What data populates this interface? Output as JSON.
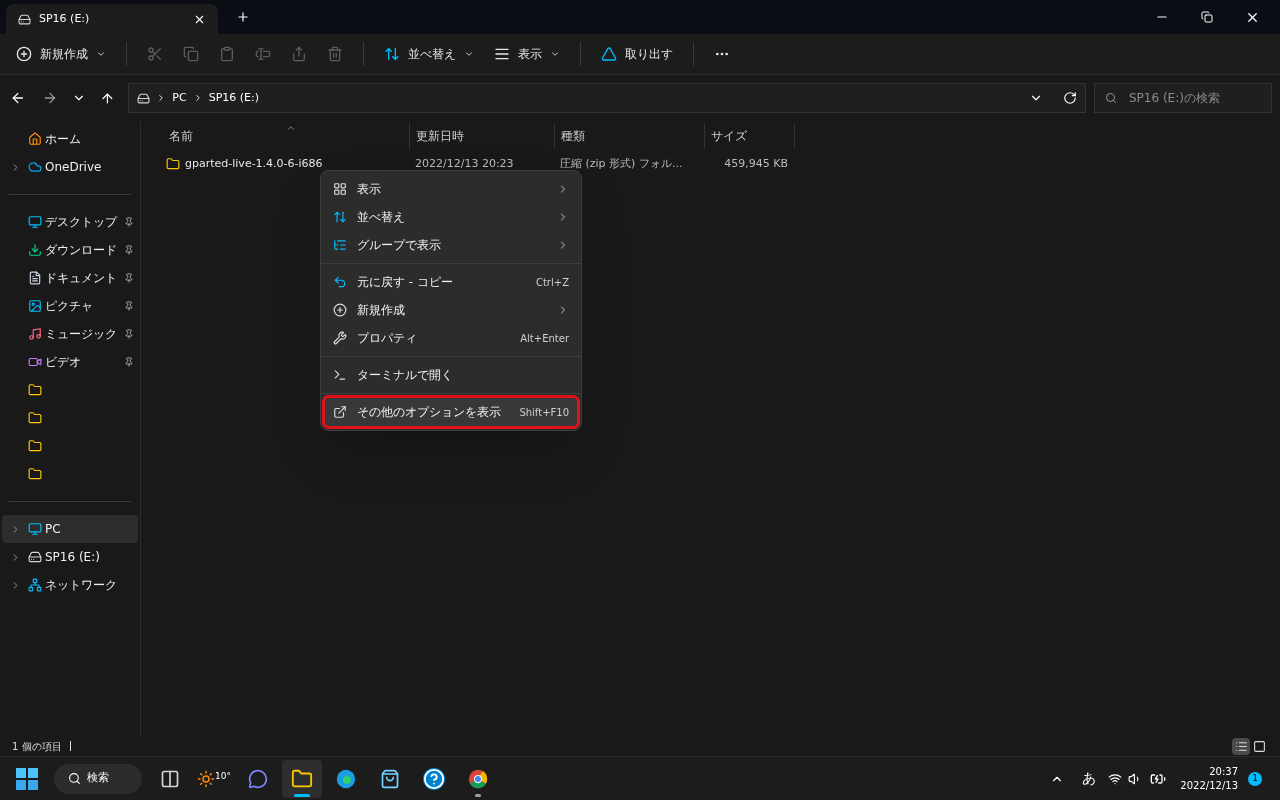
{
  "tab": {
    "title": "SP16 (E:)"
  },
  "toolbar": [
    {
      "kind": "new",
      "label": "新規作成",
      "dropdown": true,
      "disabled": false
    },
    {
      "kind": "cut",
      "disabled": true
    },
    {
      "kind": "copy",
      "disabled": true
    },
    {
      "kind": "paste",
      "disabled": true
    },
    {
      "kind": "rename",
      "disabled": true
    },
    {
      "kind": "share",
      "disabled": true
    },
    {
      "kind": "delete",
      "disabled": true
    },
    {
      "kind": "sort",
      "label": "並べ替え",
      "dropdown": true,
      "disabled": false
    },
    {
      "kind": "view",
      "label": "表示",
      "dropdown": true,
      "disabled": false
    },
    {
      "kind": "eject",
      "label": "取り出す",
      "dropdown": false,
      "disabled": false
    },
    {
      "kind": "more",
      "disabled": false
    }
  ],
  "address": {
    "crumbs": [
      "PC",
      "SP16 (E:)"
    ]
  },
  "search": {
    "placeholder": "SP16 (E:)の検索"
  },
  "sidebar": {
    "groups": [
      [
        {
          "kind": "home",
          "label": "ホーム",
          "expandable": false,
          "pinned": false,
          "selected": false
        },
        {
          "kind": "cloud",
          "label": "OneDrive",
          "expandable": true,
          "pinned": false,
          "selected": false
        }
      ],
      [
        {
          "kind": "desktop",
          "label": "デスクトップ",
          "expandable": false,
          "pinned": true,
          "selected": false
        },
        {
          "kind": "download",
          "label": "ダウンロード",
          "expandable": false,
          "pinned": true,
          "selected": false
        },
        {
          "kind": "document",
          "label": "ドキュメント",
          "expandable": false,
          "pinned": true,
          "selected": false
        },
        {
          "kind": "picture",
          "label": "ピクチャ",
          "expandable": false,
          "pinned": true,
          "selected": false
        },
        {
          "kind": "music",
          "label": "ミュージック",
          "expandable": false,
          "pinned": true,
          "selected": false
        },
        {
          "kind": "video",
          "label": "ビデオ",
          "expandable": false,
          "pinned": true,
          "selected": false
        },
        {
          "kind": "folder",
          "expandable": false,
          "pinned": false,
          "selected": false
        },
        {
          "kind": "folder",
          "expandable": false,
          "pinned": false,
          "selected": false
        },
        {
          "kind": "folder",
          "expandable": false,
          "pinned": false,
          "selected": false
        },
        {
          "kind": "folder",
          "expandable": false,
          "pinned": false,
          "selected": false
        }
      ],
      [
        {
          "kind": "pc",
          "label": "PC",
          "expandable": true,
          "pinned": false,
          "selected": true
        },
        {
          "kind": "drive",
          "label": "SP16 (E:)",
          "expandable": true,
          "pinned": false,
          "selected": false
        },
        {
          "kind": "network",
          "label": "ネットワーク",
          "expandable": true,
          "pinned": false,
          "selected": false
        }
      ]
    ]
  },
  "table": {
    "columns": [
      {
        "label": "名前",
        "sorted": true
      },
      {
        "label": "更新日時",
        "sorted": false
      },
      {
        "label": "種類",
        "sorted": false
      },
      {
        "label": "サイズ",
        "sorted": false
      }
    ],
    "rows": [
      {
        "name": "gparted-live-1.4.0-6-i686",
        "modified": "2022/12/13 20:23",
        "type": "圧縮 (zip 形式) フォル...",
        "size": "459,945 KB"
      }
    ]
  },
  "context_menu": [
    {
      "kind": "item",
      "label": "表示",
      "submenu": true,
      "highlighted": false
    },
    {
      "kind": "item",
      "label": "並べ替え",
      "submenu": true,
      "highlighted": false
    },
    {
      "kind": "item",
      "label": "グループで表示",
      "submenu": true,
      "highlighted": false
    },
    {
      "kind": "separator"
    },
    {
      "kind": "item",
      "label": "元に戻す - コピー",
      "shortcut": "Ctrl+Z",
      "submenu": false,
      "highlighted": false
    },
    {
      "kind": "item",
      "label": "新規作成",
      "submenu": true,
      "highlighted": false
    },
    {
      "kind": "item",
      "label": "プロパティ",
      "shortcut": "Alt+Enter",
      "submenu": false,
      "highlighted": false
    },
    {
      "kind": "separator"
    },
    {
      "kind": "item",
      "label": "ターミナルで開く",
      "submenu": false,
      "highlighted": false
    },
    {
      "kind": "separator"
    },
    {
      "kind": "item",
      "label": "その他のオプションを表示",
      "shortcut": "Shift+F10",
      "submenu": false,
      "highlighted": true
    }
  ],
  "status_bar": {
    "count": "1 個の項目",
    "view": [
      {
        "kind": "details",
        "selected": true
      },
      {
        "kind": "tiles",
        "selected": false
      }
    ]
  },
  "taskbar": {
    "search": "検索",
    "weather": "10°",
    "apps": [
      {
        "kind": "taskview",
        "selected": false
      },
      {
        "kind": "weather",
        "selected": false
      },
      {
        "kind": "chat",
        "selected": false
      },
      {
        "kind": "explorer",
        "selected": true
      },
      {
        "kind": "edge",
        "selected": false
      },
      {
        "kind": "store",
        "selected": false
      },
      {
        "kind": "help",
        "selected": false
      },
      {
        "kind": "chrome",
        "selected": false,
        "running": true
      }
    ],
    "ime": "あ",
    "time": "20:37",
    "date": "2022/12/13",
    "notifications": "1"
  }
}
